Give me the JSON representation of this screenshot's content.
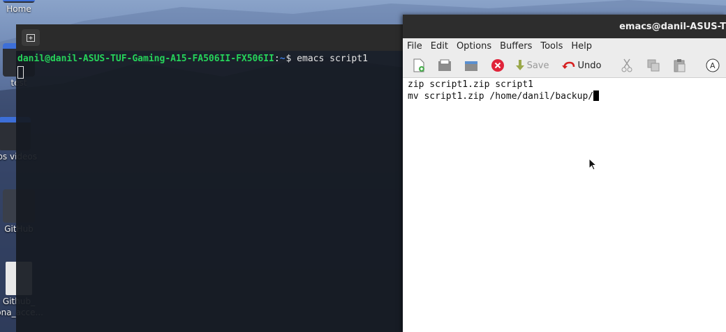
{
  "desktop": {
    "icons": [
      {
        "label": "Home"
      },
      {
        "label": "test"
      },
      {
        "label": "obs videos"
      },
      {
        "label": "GitHub"
      },
      {
        "label": "Github_"
      },
      {
        "label": "sona_acce..."
      }
    ]
  },
  "terminal": {
    "new_tab_icon": "new-tab-icon",
    "prompt_user": "danil@danil-ASUS-TUF-Gaming-A15-FA506II-FX506II",
    "prompt_sep": ":",
    "prompt_path": "~",
    "command": "$ emacs script1"
  },
  "emacs": {
    "title": "emacs@danil-ASUS-T",
    "menu": [
      "File",
      "Edit",
      "Options",
      "Buffers",
      "Tools",
      "Help"
    ],
    "toolbar": {
      "save_label": "Save",
      "undo_label": "Undo"
    },
    "buffer_lines": [
      "zip script1.zip script1",
      "mv script1.zip /home/danil/backup/"
    ]
  }
}
